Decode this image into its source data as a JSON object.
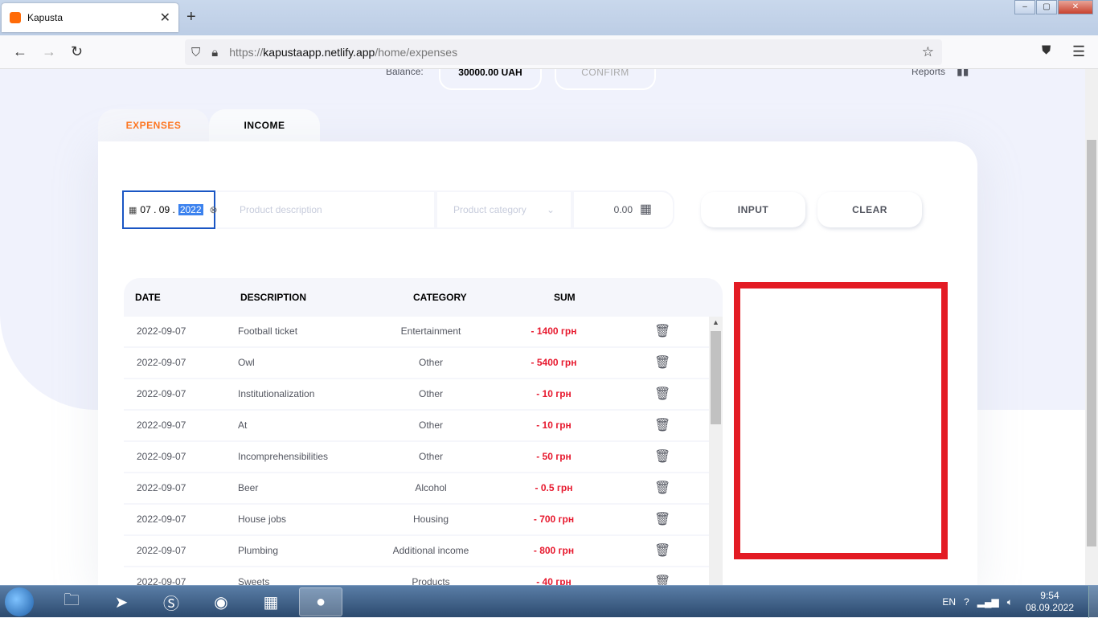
{
  "browser": {
    "tab_title": "Kapusta",
    "tab_close": "✕",
    "new_tab": "+",
    "url_prefix": "https://",
    "url_host": "kapustaapp.netlify.app",
    "url_path": "/home/expenses"
  },
  "header": {
    "balance_label": "Balance:",
    "balance_value": "30000.00 UAH",
    "confirm_label": "CONFIRM",
    "reports_label": "Reports"
  },
  "tabs": {
    "expenses": "EXPENSES",
    "income": "INCOME"
  },
  "form": {
    "date_day": "07",
    "date_month": "09",
    "date_year": "2022",
    "description_placeholder": "Product description",
    "category_placeholder": "Product category",
    "sum_value": "0.00",
    "input_label": "INPUT",
    "clear_label": "CLEAR"
  },
  "table": {
    "headers": [
      "DATE",
      "DESCRIPTION",
      "CATEGORY",
      "SUM"
    ],
    "rows": [
      {
        "date": "2022-09-07",
        "description": "Football ticket",
        "category": "Entertainment",
        "sum": "- 1400 грн"
      },
      {
        "date": "2022-09-07",
        "description": "Owl",
        "category": "Other",
        "sum": "- 5400 грн"
      },
      {
        "date": "2022-09-07",
        "description": "Institutionalization",
        "category": "Other",
        "sum": "- 10 грн"
      },
      {
        "date": "2022-09-07",
        "description": "At",
        "category": "Other",
        "sum": "- 10 грн"
      },
      {
        "date": "2022-09-07",
        "description": "Incomprehensibilities",
        "category": "Other",
        "sum": "- 50 грн"
      },
      {
        "date": "2022-09-07",
        "description": "Beer",
        "category": "Alcohol",
        "sum": "- 0.5 грн"
      },
      {
        "date": "2022-09-07",
        "description": "House jobs",
        "category": "Housing",
        "sum": "- 700 грн"
      },
      {
        "date": "2022-09-07",
        "description": "Plumbing",
        "category": "Additional income",
        "sum": "- 800 грн"
      },
      {
        "date": "2022-09-07",
        "description": "Sweets",
        "category": "Products",
        "sum": "- 40 грн"
      }
    ]
  },
  "taskbar": {
    "language": "EN",
    "time": "9:54",
    "date": "08.09.2022"
  },
  "colors": {
    "accent": "#ff751d",
    "expense": "#e7192e",
    "highlight_border": "#e31b24"
  }
}
